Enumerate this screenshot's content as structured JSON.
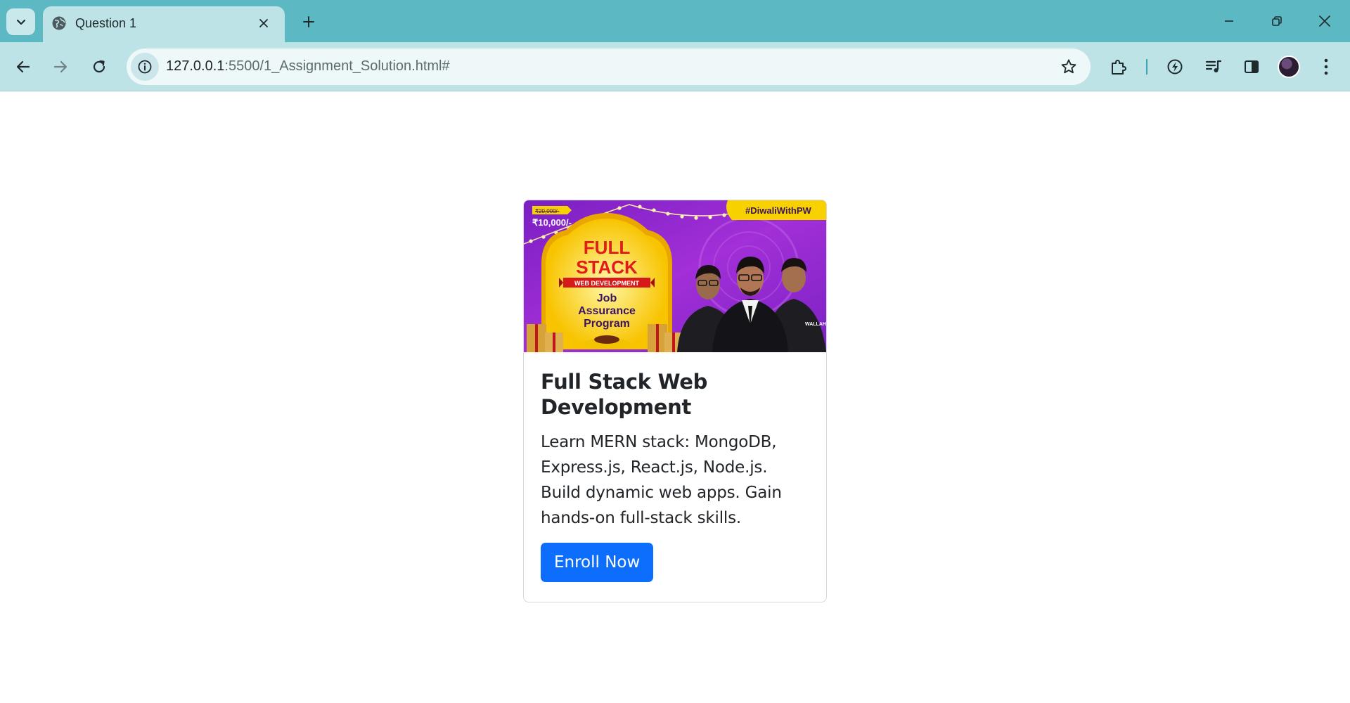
{
  "browser": {
    "tab": {
      "title": "Question 1"
    },
    "url": {
      "host": "127.0.0.1",
      "rest": ":5500/1_Assignment_Solution.html#"
    }
  },
  "card": {
    "image": {
      "hashtag": "#DiwaliWithPW",
      "old_price": "₹20,000/-",
      "price": "₹10,000/-",
      "line1": "FULL",
      "line2": "STACK",
      "ribbon": "WEB DEVELOPMENT",
      "job": "Job",
      "assurance": "Assurance",
      "program": "Program",
      "shirt_text": "WALLAH"
    },
    "title": "Full Stack Web Development",
    "text": "Learn MERN stack: MongoDB, Express.js, React.js, Node.js. Build dynamic web apps. Gain hands-on full-stack skills.",
    "button": "Enroll Now"
  },
  "colors": {
    "accent": "#0d6efd",
    "chrome": "#5cb9c3",
    "banner_purple": "#8a24c8",
    "banner_yellow": "#f8d200"
  }
}
